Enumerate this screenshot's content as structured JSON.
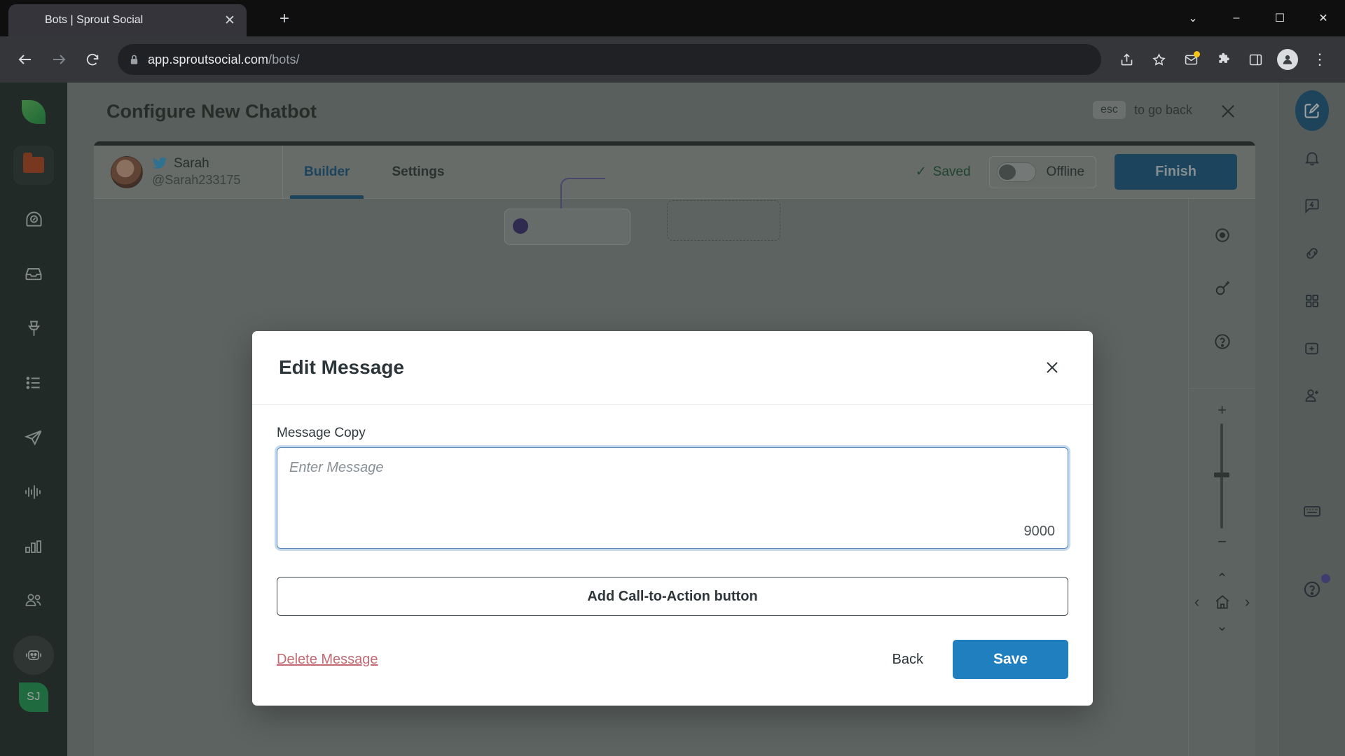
{
  "browser": {
    "tab": {
      "title": "Bots | Sprout Social",
      "favicon": "sprout-leaf-icon",
      "close": "✕"
    },
    "new_tab": "+",
    "window_controls": {
      "chevron_down": "⌄",
      "minimize": "–",
      "maximize": "☐",
      "close": "✕"
    },
    "nav": {
      "back": "←",
      "forward": "→",
      "reload": "⟳"
    },
    "omnibox": {
      "lock": "lock-icon",
      "host": "app.sproutsocial.com",
      "path": "/bots/"
    },
    "actions": {
      "share": "share-icon",
      "bookmark": "star-icon",
      "extensions": "puzzle-icon",
      "sidepanel": "panel-icon",
      "profile": "profile-icon",
      "menu": "⋮"
    }
  },
  "left_rail": {
    "logo": "sprout-leaf-logo",
    "items": [
      {
        "name": "folder-icon",
        "label": "Folder"
      },
      {
        "name": "compass-icon",
        "label": "Dashboard"
      },
      {
        "name": "inbox-icon",
        "label": "Smart Inbox"
      },
      {
        "name": "pin-icon",
        "label": "Pinned"
      },
      {
        "name": "list-icon",
        "label": "Tasks"
      },
      {
        "name": "send-icon",
        "label": "Publishing"
      },
      {
        "name": "waveform-icon",
        "label": "Listening"
      },
      {
        "name": "bar-chart-icon",
        "label": "Reports"
      },
      {
        "name": "people-icon",
        "label": "Contacts"
      },
      {
        "name": "bot-icon",
        "label": "Bots"
      }
    ],
    "user_avatar": "SJ"
  },
  "right_rail": {
    "items": [
      {
        "name": "compose-icon",
        "label": "Compose"
      },
      {
        "name": "bell-icon",
        "label": "Notifications"
      },
      {
        "name": "message-bolt-icon",
        "label": "Messages"
      },
      {
        "name": "link-icon",
        "label": "Links"
      },
      {
        "name": "grid-icon",
        "label": "Apps"
      },
      {
        "name": "add-square-icon",
        "label": "Add"
      },
      {
        "name": "add-person-icon",
        "label": "Invite"
      },
      {
        "name": "keyboard-icon",
        "label": "Shortcuts"
      },
      {
        "name": "help-icon",
        "label": "Help"
      }
    ]
  },
  "header": {
    "title": "Configure New Chatbot",
    "esc_key": "esc",
    "esc_text": "to go back",
    "close_icon": "close-icon"
  },
  "builder": {
    "bot": {
      "name": "Sarah",
      "handle": "@Sarah233175",
      "network_icon": "twitter-icon",
      "avatar": "profile-photo"
    },
    "tabs": [
      {
        "label": "Builder",
        "active": true
      },
      {
        "label": "Settings",
        "active": false
      }
    ],
    "status": {
      "check": "✓",
      "label": "Saved"
    },
    "toggle": {
      "label": "Offline",
      "on": false
    },
    "finish_label": "Finish",
    "canvas_tools": [
      {
        "name": "preview-eye-icon",
        "label": "Preview"
      },
      {
        "name": "key-icon",
        "label": "Keywords"
      },
      {
        "name": "question-icon",
        "label": "Help"
      }
    ],
    "zoom": {
      "plus": "+",
      "minus": "−"
    },
    "pan": {
      "up": "⌃",
      "down": "⌄",
      "left": "‹",
      "right": "›",
      "home": "home-icon"
    }
  },
  "modal": {
    "title": "Edit Message",
    "close_icon": "close-icon",
    "field_label": "Message Copy",
    "textarea_placeholder": "Enter Message",
    "textarea_value": "",
    "char_count": "9000",
    "cta_label": "Add Call-to-Action button",
    "delete_label": "Delete Message",
    "back_label": "Back",
    "save_label": "Save"
  },
  "colors": {
    "accent_blue": "#1f7fbf",
    "finish_blue": "#1b5c87",
    "sprout_green": "#2fa84f",
    "delete_red": "#c26a72",
    "rail_dark": "#25302c"
  }
}
